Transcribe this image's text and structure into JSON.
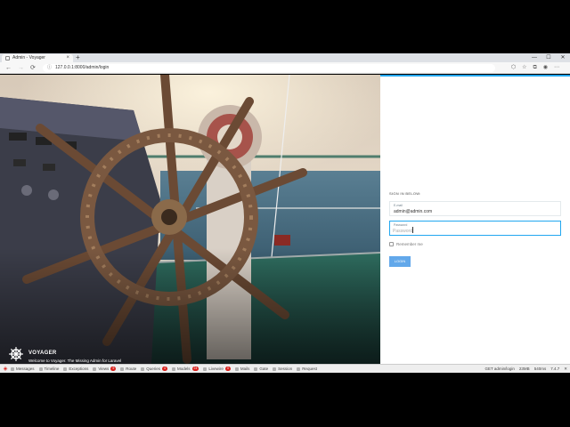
{
  "browser": {
    "tab_title": "Admin - Voyager",
    "tab_close": "×",
    "new_tab": "+",
    "window_controls": [
      "—",
      "☐",
      "✕"
    ],
    "url": "127.0.0.1:8000/admin/login",
    "nav": {
      "back": "←",
      "forward": "→",
      "reload": "⟳"
    }
  },
  "hero": {
    "brand_name": "VOYAGER",
    "brand_tagline": "Welcome to Voyager. The Missing Admin for Laravel"
  },
  "login": {
    "heading": "SIGN IN BELOW:",
    "email_label": "E-mail",
    "email_value": "admin@admin.com",
    "password_label": "Password",
    "password_placeholder": "Password",
    "remember_label": "Remember me",
    "button_label": "LOGIN",
    "accent_color": "#22a7f0",
    "button_color": "#62a8ea"
  },
  "debugbar": {
    "tabs": [
      {
        "label": "Messages",
        "badge": ""
      },
      {
        "label": "Timeline",
        "badge": ""
      },
      {
        "label": "Exceptions",
        "badge": ""
      },
      {
        "label": "Views",
        "badge": "9"
      },
      {
        "label": "Route",
        "badge": ""
      },
      {
        "label": "Queries",
        "badge": "4"
      },
      {
        "label": "Models",
        "badge": "24"
      },
      {
        "label": "Livewire",
        "badge": "0"
      },
      {
        "label": "Mails",
        "badge": ""
      },
      {
        "label": "Gate",
        "badge": ""
      },
      {
        "label": "Session",
        "badge": ""
      },
      {
        "label": "Request",
        "badge": ""
      }
    ],
    "request_info": "GET admin/login",
    "memory": "23MB",
    "duration": "540ms",
    "php_version": "7.4.7",
    "close": "✕"
  }
}
